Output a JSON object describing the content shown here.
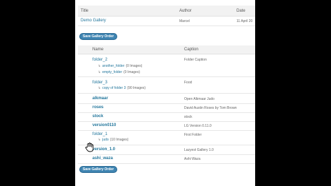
{
  "galleries_table": {
    "headers": {
      "title": "Title",
      "author": "Author",
      "date": "Date"
    },
    "row": {
      "title": "Demo Gallery",
      "author": "Marcel",
      "date": "11 April 20"
    }
  },
  "buttons": {
    "save_order_top": "Save Gallery Order",
    "save_order_bottom": "Save Gallery Order"
  },
  "folders_table": {
    "headers": {
      "name": "Name",
      "caption": "Caption"
    },
    "rows": [
      {
        "name": "folder_2",
        "caption": "Folder Caption"
      },
      {
        "name": "folder_3",
        "caption": "Food"
      },
      {
        "name": "alkmaar",
        "caption": "Open Alkmaar Judo"
      },
      {
        "name": "roses",
        "caption": "David Austin Roses by Tom Brown"
      },
      {
        "name": "stock",
        "caption": "stock"
      },
      {
        "name": "version0110",
        "caption": "LG Version 0.11.0"
      },
      {
        "name": "folder_1",
        "caption": "First Folder"
      },
      {
        "name": "version_1.0",
        "caption": "Lazyest Gallery 1.0"
      },
      {
        "name": "ashi_waza",
        "caption": "Ashi Waza"
      }
    ],
    "subfolders": [
      {
        "name": "another_folder",
        "count": "(0 Images)"
      },
      {
        "name": "empty_folder",
        "count": "(0 Images)"
      },
      {
        "name": "copy of folder 3",
        "count": "(90 Images)"
      },
      {
        "name": "judo",
        "count": "(10 Images)"
      }
    ]
  },
  "colors": {
    "link": "#21759b",
    "button": "#3f84b1",
    "header_bg": "#f2f2f2"
  }
}
